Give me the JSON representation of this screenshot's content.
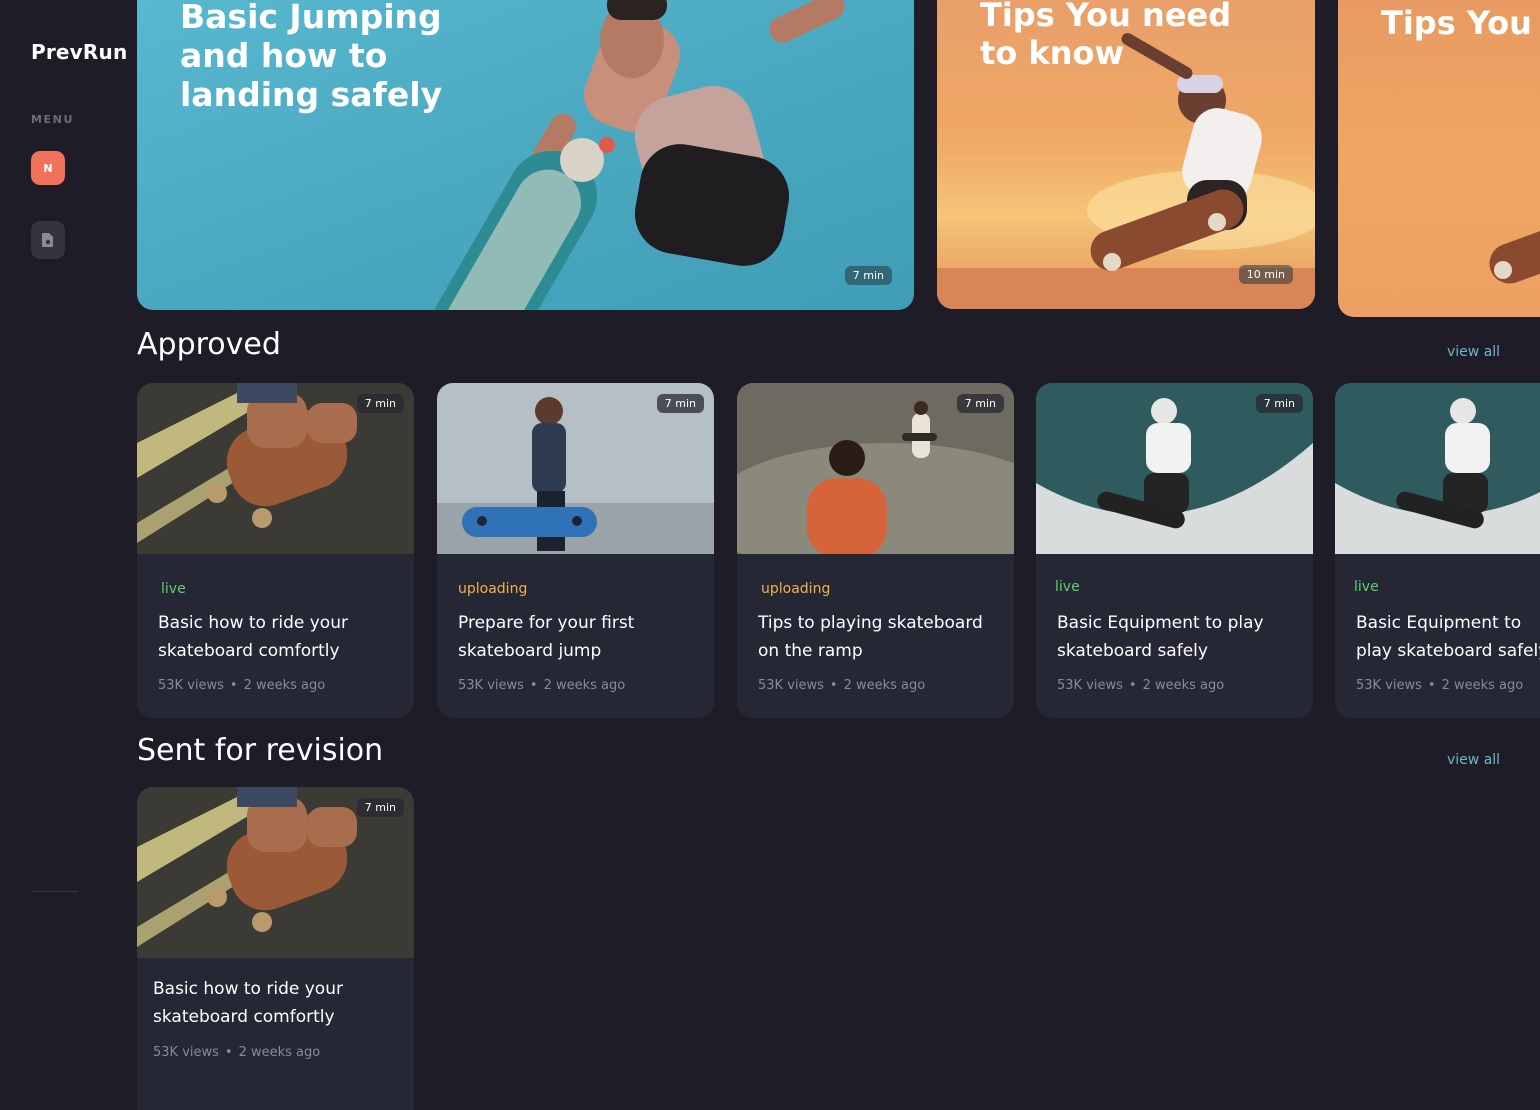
{
  "app": {
    "name": "PrevRun",
    "menu_label": "MENU",
    "nav_badge": "N"
  },
  "heroes": [
    {
      "title": "Basic Jumping and how to landing safely",
      "duration": "7 min"
    },
    {
      "title": "Tips You need to know",
      "duration": "10 min"
    },
    {
      "title": "Tips You need to know"
    }
  ],
  "sections": {
    "approved": {
      "title": "Approved",
      "view_all": "view all",
      "cards": [
        {
          "status": "live",
          "title": "Basic how to ride your skateboard comfortly",
          "views": "53K views",
          "dot": "•",
          "age": "2 weeks ago",
          "duration": "7 min"
        },
        {
          "status": "uploading",
          "title": "Prepare for your first skateboard jump",
          "views": "53K views",
          "dot": "•",
          "age": "2 weeks ago",
          "duration": "7 min"
        },
        {
          "status": "uploading",
          "title": "Tips to playing skateboard on the ramp",
          "views": "53K views",
          "dot": "•",
          "age": "2 weeks ago",
          "duration": "7 min"
        },
        {
          "status": "live",
          "title": "Basic Equipment to play skateboard safely",
          "views": "53K views",
          "dot": "•",
          "age": "2 weeks ago",
          "duration": "7 min"
        },
        {
          "status": "live",
          "title": "Basic Equipment to play skateboard safely",
          "views": "53K views",
          "dot": "•",
          "age": "2 weeks ago"
        }
      ]
    },
    "revision": {
      "title": "Sent for revision",
      "view_all": "view all",
      "cards": [
        {
          "title": "Basic how to ride your skateboard comfortly",
          "views": "53K views",
          "dot": "•",
          "age": "2 weeks ago",
          "duration": "7 min"
        }
      ]
    }
  },
  "colors": {
    "background": "#1d1c27",
    "card": "#262734",
    "accent": "#f0725a",
    "live": "#5fd06a",
    "uploading": "#f0b24a",
    "link": "#6fb5c9"
  }
}
